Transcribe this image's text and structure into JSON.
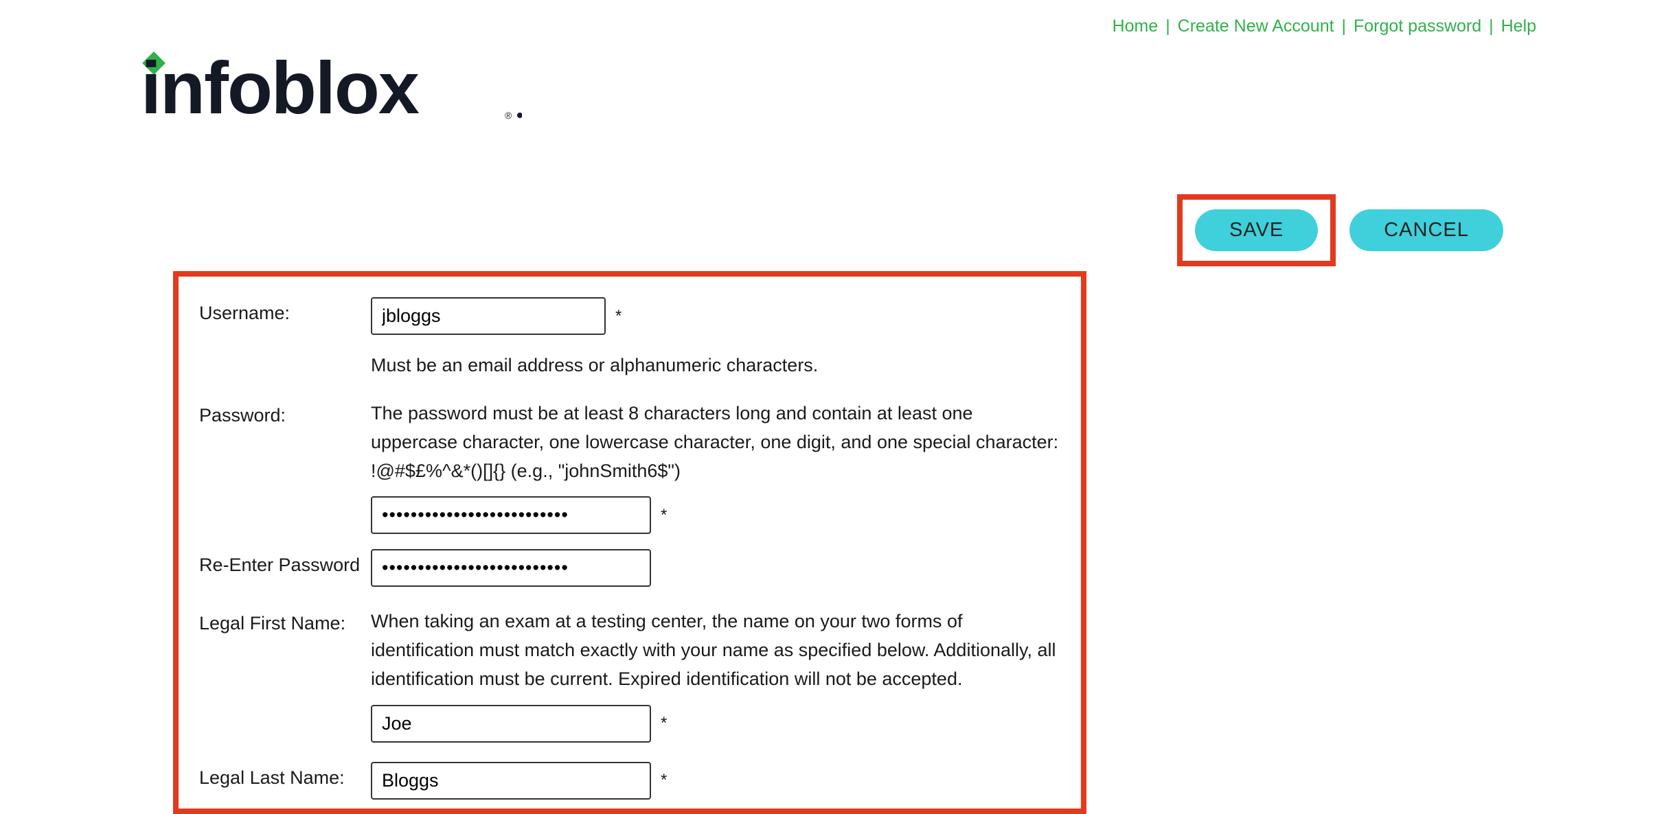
{
  "nav": {
    "home": "Home",
    "create": "Create New Account",
    "forgot": "Forgot password",
    "help": "Help",
    "sep": "|"
  },
  "logo": {
    "brand": "infoblox"
  },
  "actions": {
    "save": "SAVE",
    "cancel": "CANCEL"
  },
  "form": {
    "username": {
      "label": "Username:",
      "value": "jbloggs",
      "req": "*",
      "help": "Must be an email address or alphanumeric characters."
    },
    "password": {
      "label": "Password:",
      "help": "The password must be at least 8 characters long and contain at least one uppercase character, one lowercase character, one digit, and one special character: !@#$£%^&*()[]{} (e.g., \"johnSmith6$\")",
      "value": "••••••••••••••••••••••••••",
      "req": "*"
    },
    "repassword": {
      "label": "Re-Enter Password",
      "value": "••••••••••••••••••••••••••"
    },
    "firstname": {
      "label": "Legal First Name:",
      "help": "When taking an exam at a testing center, the name on your two forms of identification must match exactly with your name as specified below. Additionally, all identification must be current. Expired identification will not be accepted.",
      "value": "Joe",
      "req": "*"
    },
    "lastname": {
      "label": "Legal Last Name:",
      "value": "Bloggs",
      "req": "*"
    }
  }
}
